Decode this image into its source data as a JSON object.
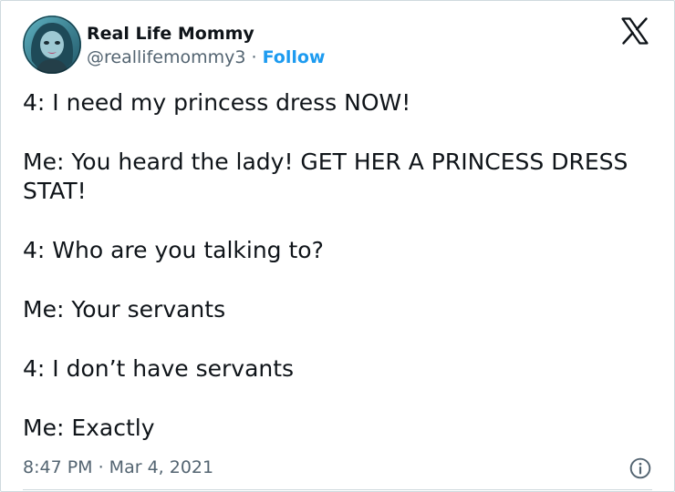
{
  "tweet": {
    "author": {
      "display_name": "Real Life Mommy",
      "handle": "@reallifemommy3",
      "separator": "·",
      "follow_label": "Follow"
    },
    "paragraphs": [
      "4: I need my princess dress NOW!",
      "Me: You heard the lady! GET HER A PRINCESS DRESS STAT!",
      "4: Who are you talking to?",
      "Me: Your servants",
      "4: I don’t have servants",
      "Me: Exactly"
    ],
    "timestamp": "8:47 PM · Mar 4, 2021"
  },
  "icons": {
    "logo": "x-logo-icon",
    "info": "info-icon",
    "avatar": "avatar"
  },
  "colors": {
    "text": "#0f1419",
    "secondary": "#536471",
    "link": "#1d9bf0",
    "border": "#cfd9de"
  }
}
